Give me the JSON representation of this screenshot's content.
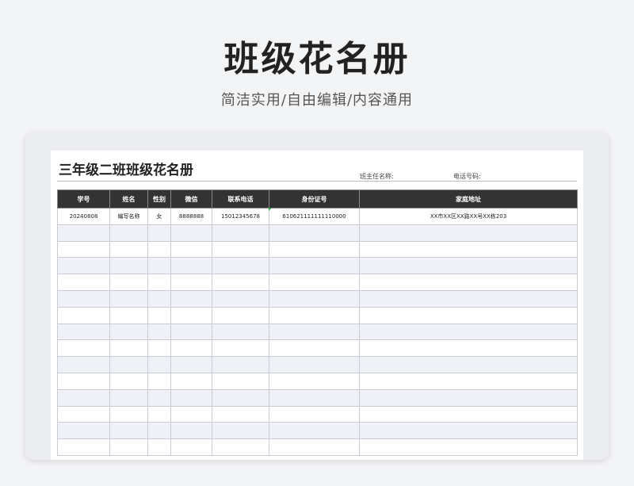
{
  "hero": {
    "title": "班级花名册",
    "subtitle": "简洁实用/自由编辑/内容通用"
  },
  "sheet": {
    "title": "三年级二班班级花名册",
    "teacher_label": "班主任名称:",
    "phone_label": "电话号码:"
  },
  "table": {
    "headers": [
      "学号",
      "姓名",
      "性别",
      "微信",
      "联系电话",
      "身份证号",
      "家庭地址"
    ],
    "rows": [
      [
        "20240808",
        "编写名称",
        "女",
        "8888888",
        "15012345678",
        "610621111111110000",
        "XX市XX区XX路XX号XX栋203"
      ]
    ],
    "empty_row_count": 14
  },
  "colors": {
    "header_bg": "#333333",
    "stripe": "#f0f1f6",
    "page_bg": "#f3f4f6",
    "marker": "#2e9e3f"
  }
}
